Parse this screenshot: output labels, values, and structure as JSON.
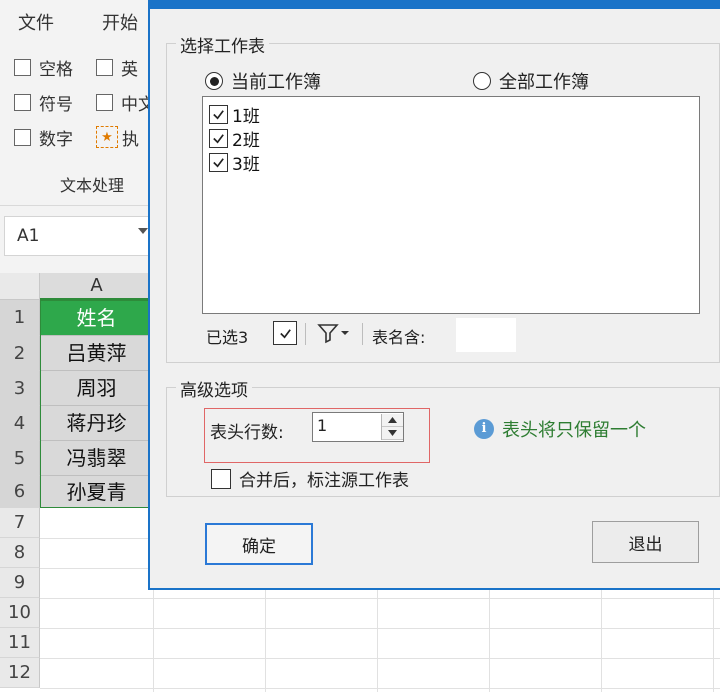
{
  "app": {
    "menu": [
      "文件",
      "开始"
    ],
    "ribbon": {
      "col1": [
        "空格",
        "符号",
        "数字"
      ],
      "col2": [
        "英",
        "中文",
        "执"
      ],
      "group_label": "文本处理"
    },
    "name_box": "A1",
    "column_header": "A",
    "row_numbers": [
      "1",
      "2",
      "3",
      "4",
      "5",
      "6",
      "7",
      "8",
      "9",
      "10",
      "11",
      "12"
    ],
    "cells": [
      "姓名",
      "吕黄萍",
      "周羽",
      "蒋丹珍",
      "冯翡翠",
      "孙夏青"
    ]
  },
  "dialog": {
    "section_select": "选择工作表",
    "radio_current": "当前工作簿",
    "radio_all": "全部工作簿",
    "radio_selected": "current",
    "sheets": [
      {
        "label": "1班",
        "checked": true
      },
      {
        "label": "2班",
        "checked": true
      },
      {
        "label": "3班",
        "checked": true
      }
    ],
    "selected_count": "已选3",
    "name_contains_label": "表名含:",
    "name_contains_value": "",
    "section_advanced": "高级选项",
    "header_rows_label": "表头行数:",
    "header_rows_value": "1",
    "info_text": "表头将只保留一个",
    "merge_label": "合并后，标注源工作表",
    "merge_checked": false,
    "ok_button": "确定",
    "exit_button": "退出"
  }
}
